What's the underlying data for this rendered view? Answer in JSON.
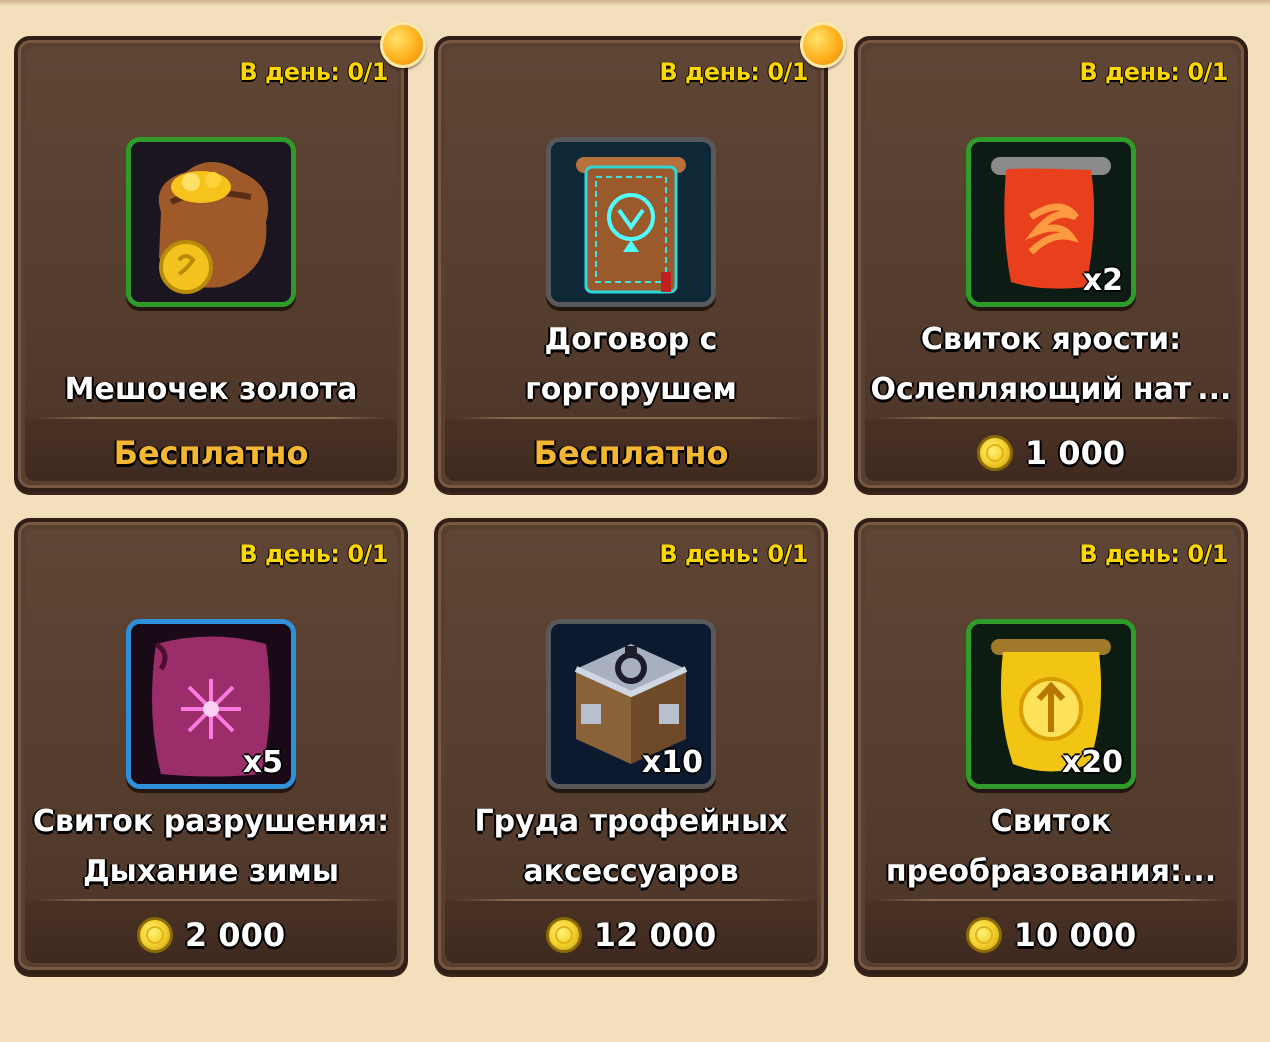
{
  "shop": {
    "items": [
      {
        "daily_limit": "В день: 0/1",
        "name": "Мешочек золота",
        "quantity": "",
        "price": "Бесплатно",
        "price_type": "free",
        "icon": "gold-pouch-icon",
        "rarity_color": "#2f9b2a",
        "has_notification": true
      },
      {
        "daily_limit": "В день: 0/1",
        "name": "Договор с\nгоргорушем",
        "quantity": "",
        "price": "Бесплатно",
        "price_type": "free",
        "icon": "contract-scroll-icon",
        "rarity_color": "#59585a",
        "has_notification": true
      },
      {
        "daily_limit": "В день: 0/1",
        "name": "Свиток ярости:\nОслепляющий нат ...",
        "quantity": "x2",
        "price": "1 000",
        "price_type": "coins",
        "icon": "fury-scroll-icon",
        "rarity_color": "#2f9b2a",
        "has_notification": false
      },
      {
        "daily_limit": "В день: 0/1",
        "name": "Свиток разрушения:\nДыхание зимы",
        "quantity": "x5",
        "price": "2 000",
        "price_type": "coins",
        "icon": "destruction-scroll-icon",
        "rarity_color": "#2f8fd8",
        "has_notification": false
      },
      {
        "daily_limit": "В день: 0/1",
        "name": "Груда трофейных\nаксессуаров",
        "quantity": "x10",
        "price": "12 000",
        "price_type": "coins",
        "icon": "accessory-chest-icon",
        "rarity_color": "#59585a",
        "has_notification": false
      },
      {
        "daily_limit": "В день: 0/1",
        "name": "Свиток\nпреобразования:...",
        "quantity": "x20",
        "price": "10 000",
        "price_type": "coins",
        "icon": "transformation-scroll-icon",
        "rarity_color": "#2f9b2a",
        "has_notification": false
      }
    ]
  },
  "colors": {
    "background": "#f3dfbc",
    "card": "#584031",
    "daily_text": "#ffd700",
    "free_text": "#f5b731",
    "coin": "#f4d12e"
  }
}
